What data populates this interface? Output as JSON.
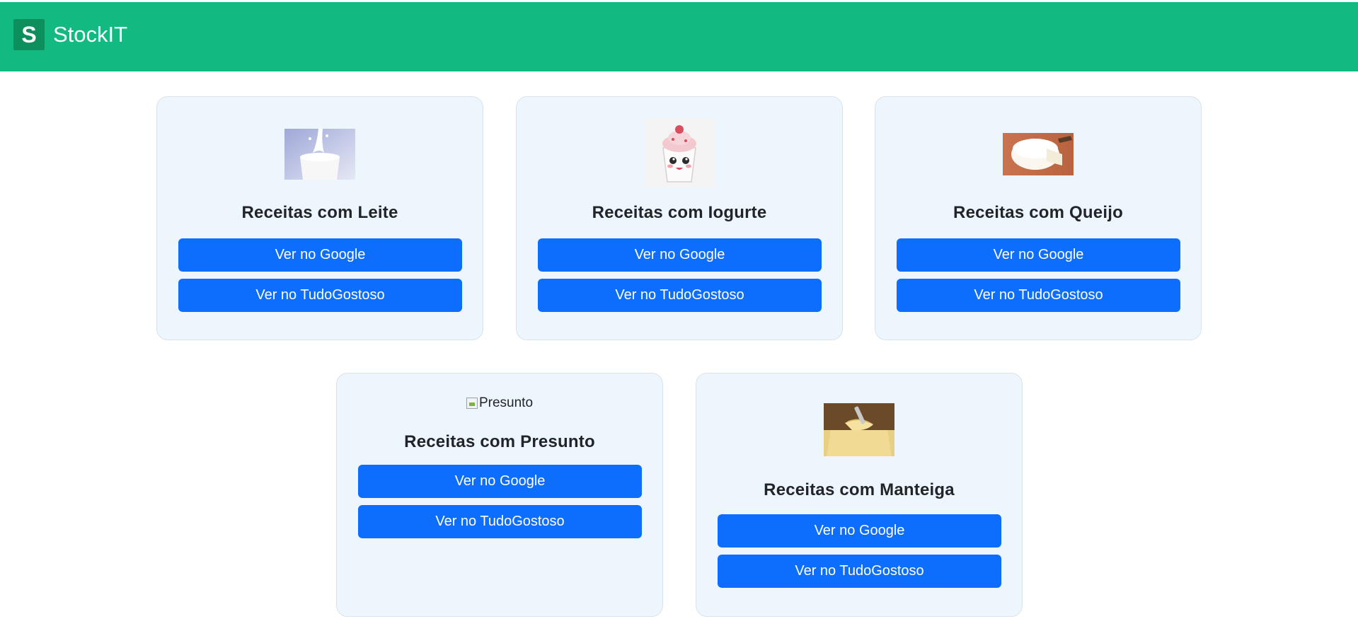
{
  "app": {
    "logo_letter": "S",
    "name": "StockIT"
  },
  "colors": {
    "navbar": "#12b981",
    "logo_bg": "#0c8f5c",
    "card_bg": "#eef6fd",
    "button": "#0d6efd"
  },
  "cards": [
    {
      "title": "Receitas com Leite",
      "image": "milk-glass-image",
      "google_label": "Ver no Google",
      "tudogostoso_label": "Ver no TudoGostoso"
    },
    {
      "title": "Receitas com Iogurte",
      "image": "yogurt-cartoon-image",
      "google_label": "Ver no Google",
      "tudogostoso_label": "Ver no TudoGostoso"
    },
    {
      "title": "Receitas com Queijo",
      "image": "cheese-image",
      "google_label": "Ver no Google",
      "tudogostoso_label": "Ver no TudoGostoso"
    },
    {
      "title": "Receitas com Presunto",
      "image_alt": "Presunto",
      "google_label": "Ver no Google",
      "tudogostoso_label": "Ver no TudoGostoso"
    },
    {
      "title": "Receitas com Manteiga",
      "image": "butter-image",
      "google_label": "Ver no Google",
      "tudogostoso_label": "Ver no TudoGostoso"
    }
  ]
}
